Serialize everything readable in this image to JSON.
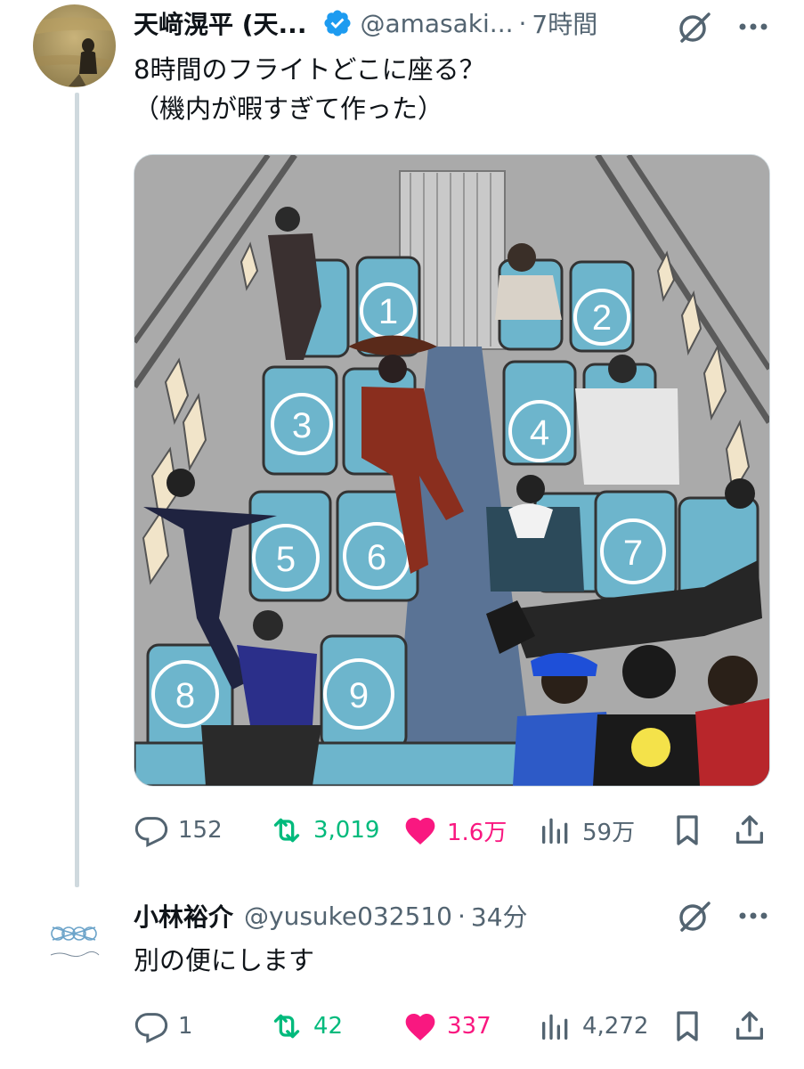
{
  "tweet": {
    "author_name": "天﨑滉平 (天...",
    "handle": "@amasaki...",
    "time": "7時間",
    "text_line1": "8時間のフライトどこに座る？",
    "text_line2": "（機内が暇すぎて作った）",
    "image_alt": "機内座席イラスト",
    "seat_numbers": [
      "1",
      "2",
      "3",
      "4",
      "5",
      "6",
      "7",
      "8",
      "9"
    ],
    "counts": {
      "replies": "152",
      "retweets": "3,019",
      "likes": "1.6万",
      "views": "59万"
    },
    "liked": true
  },
  "reply": {
    "author_name": "小林裕介",
    "handle": "@yusuke032510",
    "time": "34分",
    "text": "別の便にします",
    "counts": {
      "replies": "1",
      "retweets": "42",
      "likes": "337",
      "views": "4,272"
    },
    "liked": true
  },
  "colors": {
    "text_primary": "#0f1419",
    "text_secondary": "#536471",
    "retweet_green": "#00ba7c",
    "like_pink": "#f91880",
    "verified_blue": "#1d9bf0",
    "seat_blue": "#6db5cc"
  },
  "icons": [
    "verified-badge-icon",
    "grok-icon",
    "more-icon",
    "reply-icon",
    "retweet-icon",
    "like-icon",
    "views-icon",
    "bookmark-icon",
    "share-icon"
  ]
}
